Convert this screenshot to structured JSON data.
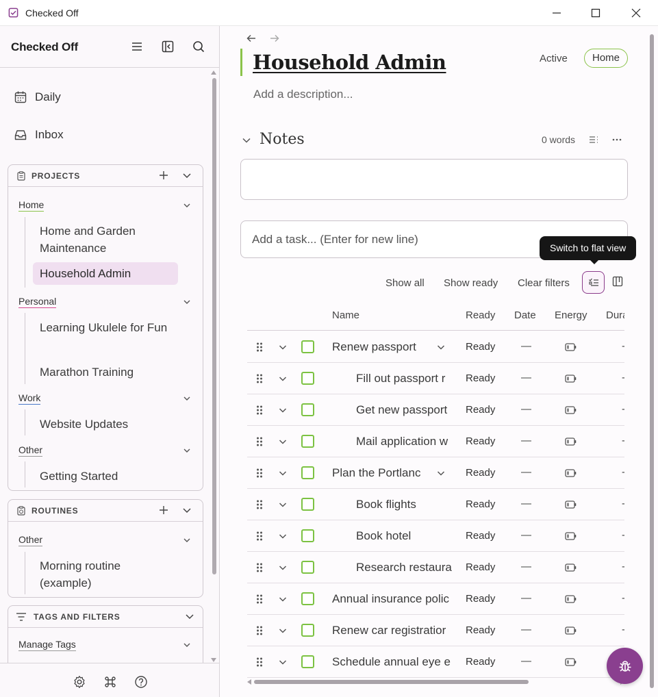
{
  "window": {
    "title": "Checked Off"
  },
  "sidebar": {
    "brand": "Checked Off",
    "nav": [
      {
        "label": "Daily",
        "icon": "calendar-icon"
      },
      {
        "label": "Inbox",
        "icon": "inbox-icon"
      }
    ],
    "projects": {
      "title": "PROJECTS",
      "groups": [
        {
          "label": "Home",
          "color": "#8bc34a",
          "items": [
            "Home and Garden Maintenance",
            "Household Admin"
          ]
        },
        {
          "label": "Personal",
          "color": "#d4488f",
          "items": [
            "Learning Ukulele for Fun",
            "Marathon Training"
          ]
        },
        {
          "label": "Work",
          "color": "#4a78c8",
          "items": [
            "Website Updates"
          ]
        },
        {
          "label": "Other",
          "color": "#9a9a9a",
          "items": [
            "Getting Started"
          ]
        }
      ]
    },
    "routines": {
      "title": "ROUTINES",
      "groups": [
        {
          "label": "Other",
          "color": "#9a9a9a",
          "items": [
            "Morning routine (example)"
          ]
        }
      ]
    },
    "tags": {
      "title": "TAGS AND FILTERS",
      "manage_label": "Manage Tags"
    }
  },
  "project": {
    "title": "Household Admin",
    "status": "Active",
    "area": "Home",
    "description_placeholder": "Add a description...",
    "accent": "#8bc34a"
  },
  "notes": {
    "title": "Notes",
    "word_count": "0 words"
  },
  "task_input": {
    "placeholder": "Add a task... (Enter for new line)"
  },
  "tooltip": "Switch to flat view",
  "filters": {
    "show_all": "Show all",
    "show_ready": "Show ready",
    "clear_filters": "Clear filters"
  },
  "table": {
    "columns": [
      "Name",
      "Ready",
      "Date",
      "Energy",
      "Dura"
    ],
    "rows": [
      {
        "name": "Renew passport",
        "indent": 0,
        "has_children": true,
        "ready": "Ready",
        "date": "—",
        "duration": "-"
      },
      {
        "name": "Fill out passport r",
        "indent": 1,
        "has_children": false,
        "ready": "Ready",
        "date": "—",
        "duration": "-"
      },
      {
        "name": "Get new passport",
        "indent": 1,
        "has_children": false,
        "ready": "Ready",
        "date": "—",
        "duration": "-"
      },
      {
        "name": "Mail application w",
        "indent": 1,
        "has_children": false,
        "ready": "Ready",
        "date": "—",
        "duration": "-"
      },
      {
        "name": "Plan the Portlanc",
        "indent": 0,
        "has_children": true,
        "ready": "Ready",
        "date": "—",
        "duration": "-"
      },
      {
        "name": "Book flights",
        "indent": 1,
        "has_children": false,
        "ready": "Ready",
        "date": "—",
        "duration": "-"
      },
      {
        "name": "Book hotel",
        "indent": 1,
        "has_children": false,
        "ready": "Ready",
        "date": "—",
        "duration": "-"
      },
      {
        "name": "Research restaura",
        "indent": 1,
        "has_children": false,
        "ready": "Ready",
        "date": "—",
        "duration": "-"
      },
      {
        "name": "Annual insurance polic",
        "indent": 0,
        "has_children": false,
        "ready": "Ready",
        "date": "—",
        "duration": "-"
      },
      {
        "name": "Renew car registratior",
        "indent": 0,
        "has_children": false,
        "ready": "Ready",
        "date": "—",
        "duration": "-"
      },
      {
        "name": "Schedule annual eye e",
        "indent": 0,
        "has_children": false,
        "ready": "Ready",
        "date": "—",
        "duration": "-"
      }
    ]
  },
  "colors": {
    "accent_purple": "#8a3f8f",
    "checkbox_green": "#7cc242"
  }
}
